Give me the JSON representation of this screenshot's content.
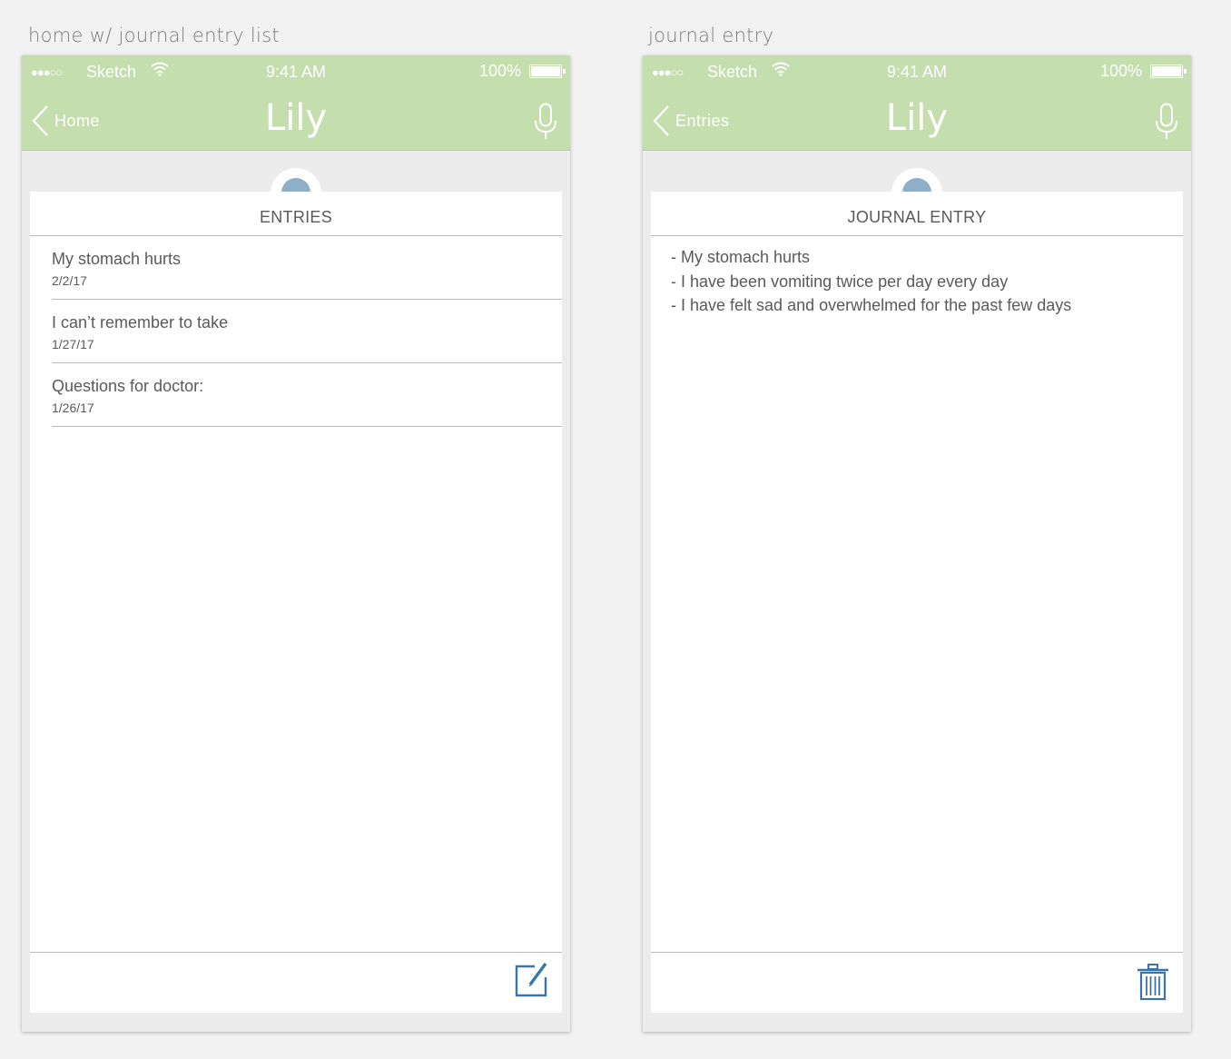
{
  "screens": [
    {
      "artboard_label": "home w/ journal entry list",
      "status": {
        "carrier": "Sketch",
        "time": "9:41 AM",
        "battery": "100%"
      },
      "nav": {
        "back_label": "Home",
        "title": "Lily"
      },
      "section_title": "ENTRIES",
      "entries": [
        {
          "title": "My stomach hurts",
          "date": "2/2/17"
        },
        {
          "title": "I can’t remember to take",
          "date": "1/27/17"
        },
        {
          "title": "Questions for doctor:",
          "date": "1/26/17"
        }
      ],
      "footer_icon": "compose-icon"
    },
    {
      "artboard_label": "journal entry",
      "status": {
        "carrier": "Sketch",
        "time": "9:41 AM",
        "battery": "100%"
      },
      "nav": {
        "back_label": "Entries",
        "title": "Lily"
      },
      "section_title": "JOURNAL ENTRY",
      "lines": [
        "- My stomach hurts",
        "- I have been vomiting twice per day every day",
        "- I have felt sad and overwhelmed for the past few days"
      ],
      "footer_icon": "trash-icon"
    }
  ],
  "colors": {
    "header_green": "#c4deae",
    "avatar_blue": "#8fafc9",
    "icon_blue": "#3a74a8"
  }
}
